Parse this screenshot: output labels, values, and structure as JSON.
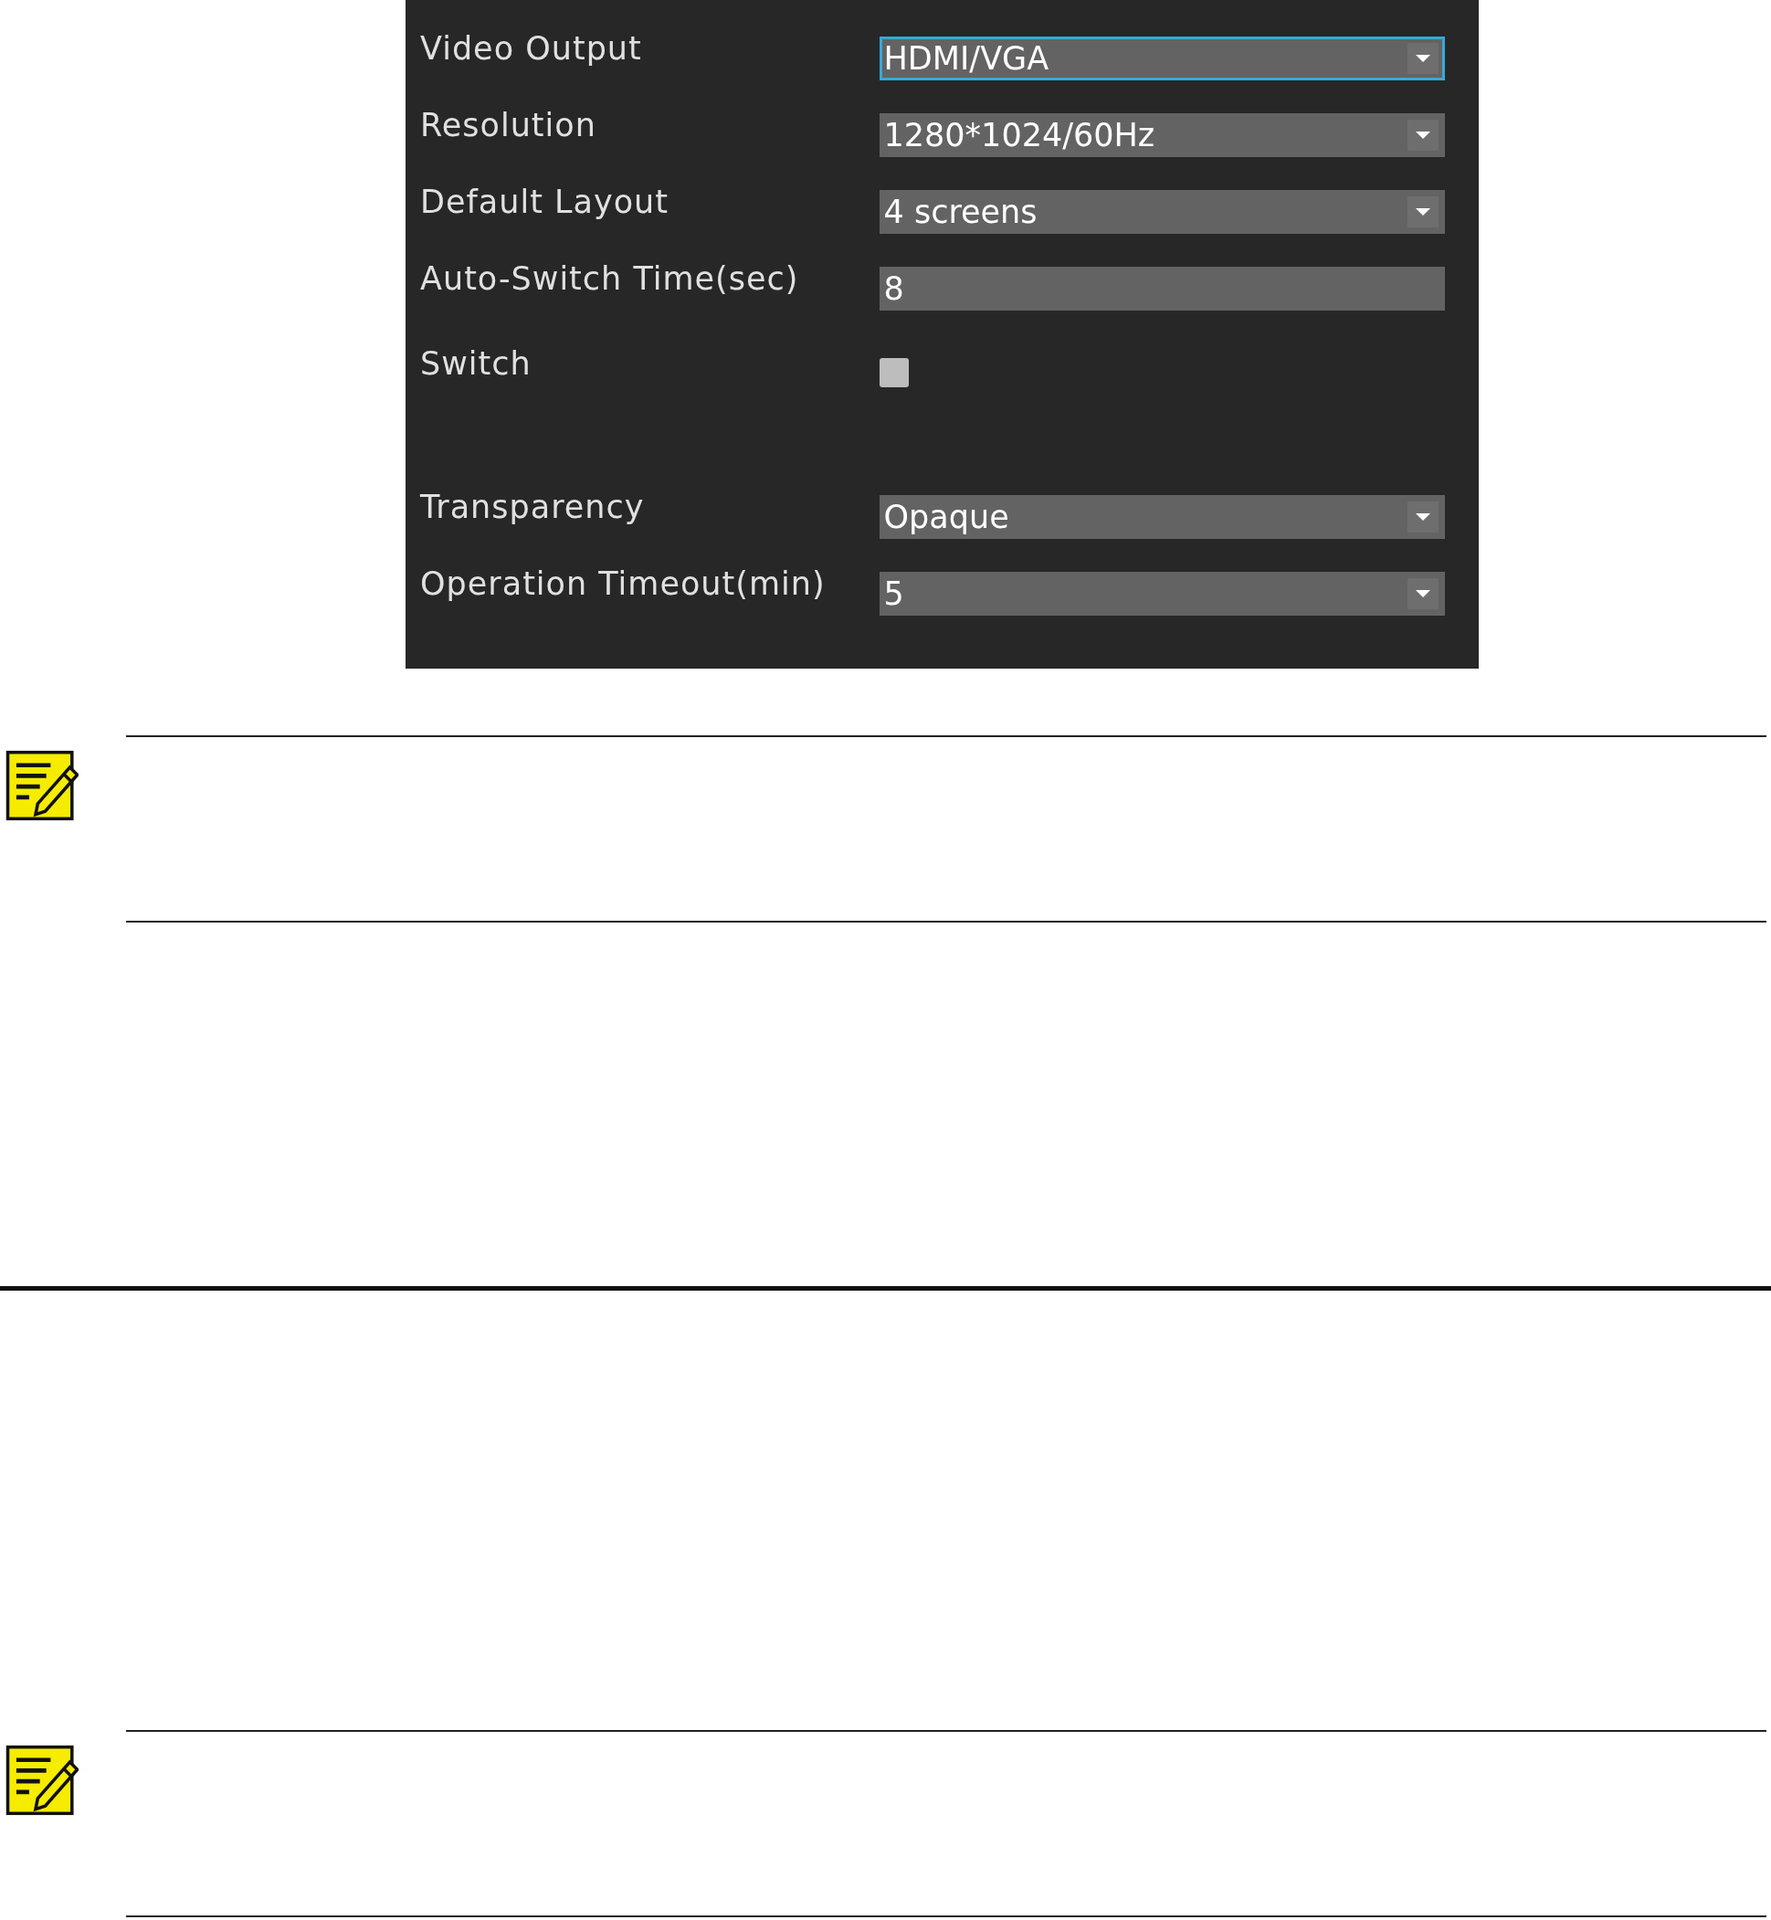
{
  "settings_panel": {
    "rows": [
      {
        "label": "Video Output",
        "kind": "select",
        "value": "HDMI/VGA",
        "focused": true
      },
      {
        "label": "Resolution",
        "kind": "select",
        "value": "1280*1024/60Hz",
        "focused": false
      },
      {
        "label": "Default Layout",
        "kind": "select",
        "value": "4 screens",
        "focused": false
      },
      {
        "label": "Auto-Switch Time(sec)",
        "kind": "input",
        "value": "8",
        "focused": false
      },
      {
        "label": "Switch",
        "kind": "checkbox",
        "checked": false
      },
      {
        "label": "Transparency",
        "kind": "select",
        "value": "Opaque",
        "focused": false
      },
      {
        "label": "Operation Timeout(min)",
        "kind": "select",
        "value": "5",
        "focused": false
      }
    ]
  },
  "notes": [
    {
      "kind": "note"
    },
    {
      "kind": "note"
    }
  ]
}
